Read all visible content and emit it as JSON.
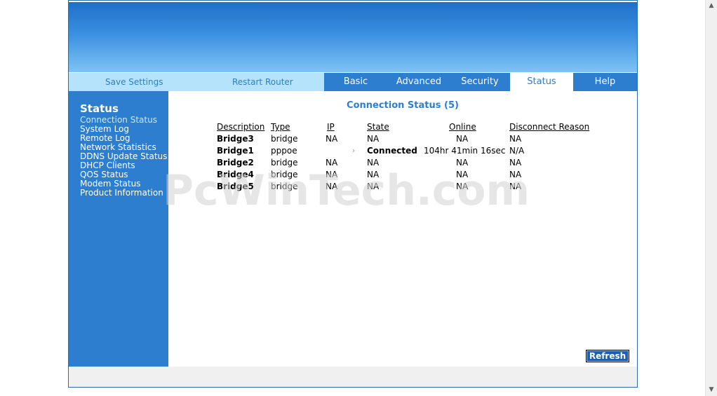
{
  "nav": {
    "left_links": [
      "Save Settings",
      "Restart Router"
    ],
    "tabs": [
      "Basic",
      "Advanced",
      "Security",
      "Status",
      "Help"
    ],
    "active_tab": "Status"
  },
  "sidebar": {
    "title": "Status",
    "items": [
      "Connection Status",
      "System Log",
      "Remote Log",
      "Network Statistics",
      "DDNS Update Status",
      "DHCP Clients",
      "QOS Status",
      "Modem Status",
      "Product Information"
    ],
    "current": "Connection Status"
  },
  "content": {
    "title": "Connection Status (5)",
    "headers": [
      "Description",
      "Type",
      "IP",
      "State",
      "Online",
      "Disconnect Reason"
    ],
    "rows": [
      [
        "Bridge3",
        "bridge",
        "NA",
        "NA",
        "NA",
        "NA"
      ],
      [
        "Bridge1",
        "pppoe",
        "",
        "Connected",
        "104hr 41min 16sec",
        "N/A"
      ],
      [
        "Bridge2",
        "bridge",
        "NA",
        "NA",
        "NA",
        "NA"
      ],
      [
        "Bridge4",
        "bridge",
        "NA",
        "NA",
        "NA",
        "NA"
      ],
      [
        "Bridge5",
        "bridge",
        "NA",
        "NA",
        "NA",
        "NA"
      ]
    ],
    "refresh_label": "Refresh"
  },
  "watermark": "PcWinTech.com",
  "colors": {
    "primary_blue": "#2e7ed0",
    "light_nav": "#b5e3fb",
    "link": "#2f7fbe",
    "footer": "#f0f0f0"
  }
}
